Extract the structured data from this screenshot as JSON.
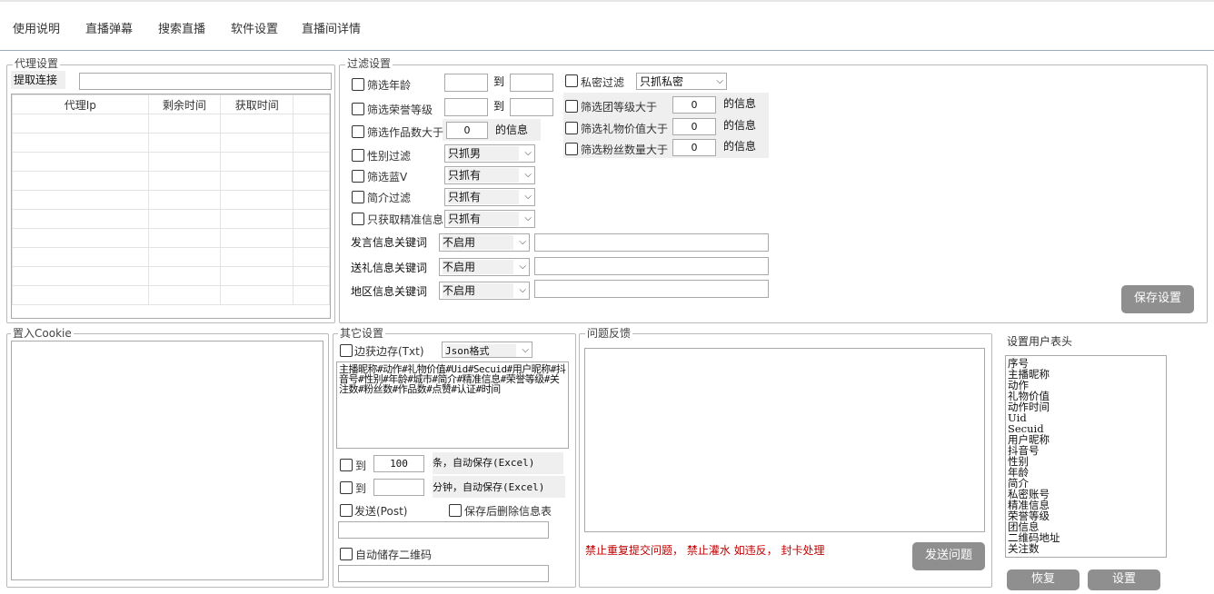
{
  "menu": [
    "使用说明",
    "直播弹幕",
    "搜索直播",
    "软件设置",
    "直播间详情"
  ],
  "proxy": {
    "legend": "代理设置",
    "fetch_label": "提取连接",
    "fetch_value": "",
    "columns": [
      "代理Ip",
      "剩余时间",
      "获取时间"
    ]
  },
  "filter": {
    "legend": "过滤设置",
    "age_label": "筛选年龄",
    "to1": "到",
    "honor_label": "筛选荣誉等级",
    "to2": "到",
    "works_label": "筛选作品数大于",
    "works_value": "0",
    "works_suffix": "的信息",
    "gender_label": "性别过滤",
    "gender_value": "只抓男",
    "bluev_label": "筛选蓝V",
    "bluev_value": "只抓有",
    "bio_label": "简介过滤",
    "bio_value": "只抓有",
    "precise_label": "只获取精准信息",
    "precise_value": "只抓有",
    "private_label": "私密过滤",
    "private_value": "只抓私密",
    "group_label": "筛选团等级大于",
    "group_value": "0",
    "group_suffix": "的信息",
    "gift_label": "筛选礼物价值大于",
    "gift_value": "0",
    "gift_suffix": "的信息",
    "fans_label": "筛选粉丝数量大于",
    "fans_value": "0",
    "fans_suffix": "的信息",
    "speech_kw_label": "发言信息关键词",
    "speech_kw_value": "不启用",
    "gift_kw_label": "送礼信息关键词",
    "gift_kw_value": "不启用",
    "region_kw_label": "地区信息关键词",
    "region_kw_value": "不启用",
    "save_button": "保存设置"
  },
  "cookie": {
    "legend": "置入Cookie"
  },
  "other": {
    "legend": "其它设置",
    "edge_label": "边获边存(Txt)",
    "format_value": "Json格式",
    "template_text": "主播昵称#动作#礼物价值#Uid#Secuid#用户昵称#抖音号#性别#年龄#城市#简介#精准信息#荣誉等级#关注数#粉丝数#作品数#点赞#认证#时间",
    "count_to": "到",
    "count_value": "100",
    "count_suffix": "条，自动保存(Excel)",
    "minutes_to": "到",
    "minutes_value": "",
    "minutes_suffix": "分钟，自动保存(Excel)",
    "post_label": "发送(Post)",
    "delete_label": "保存后删除信息表",
    "post_value": "",
    "qr_label": "自动储存二维码",
    "qr_value": ""
  },
  "feedback": {
    "legend": "问题反馈",
    "notice": "禁止重复提交问题， 禁止灌水 如违反， 封卡处理",
    "send_button": "发送问题"
  },
  "header_setting": {
    "title": "设置用户表头",
    "items": [
      "序号",
      "主播昵称",
      "动作",
      "礼物价值",
      "动作时间",
      "Uid",
      "Secuid",
      "用户昵称",
      "抖音号",
      "性别",
      "年龄",
      "简介",
      "私密账号",
      "精准信息",
      "荣誉等级",
      "团信息",
      "二维码地址",
      "关注数"
    ],
    "restore_button": "恢复",
    "set_button": "设置"
  },
  "colors": {
    "button": "#8f8f8f",
    "notice": "#c00000"
  }
}
